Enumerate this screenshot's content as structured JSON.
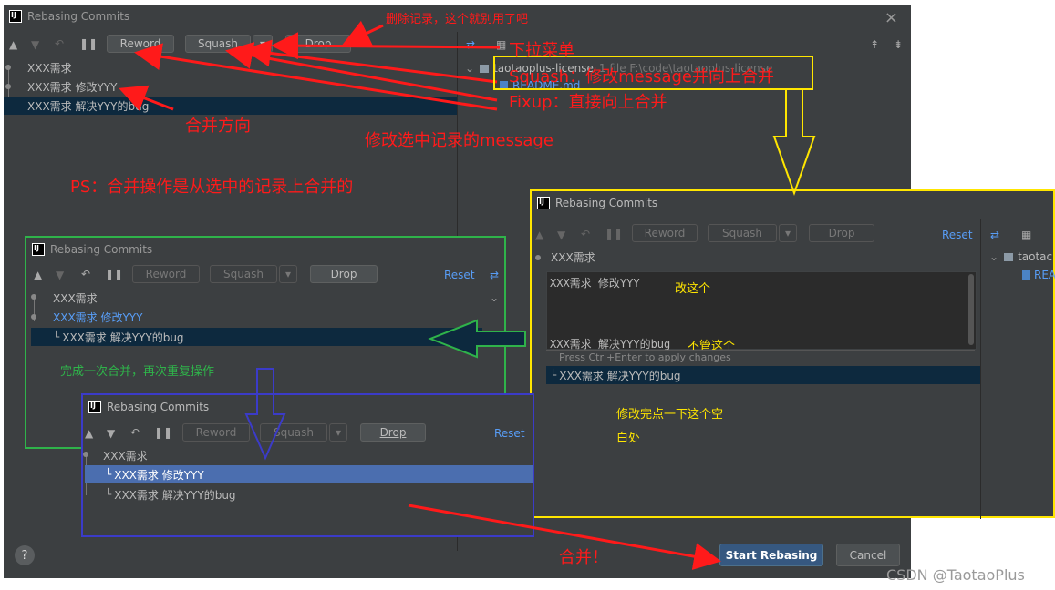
{
  "main": {
    "title": "Rebasing Commits",
    "close": "×",
    "buttons": {
      "reword": "Reword",
      "squash": "Squash",
      "drop": "Drop"
    },
    "commits": [
      "XXX需求",
      "XXX需求 修改YYY",
      "XXX需求 解决YYY的bug"
    ],
    "tree": {
      "repo": "taotaoplus-license",
      "repo_path": "1 file F:\\code\\taotaoplus-license",
      "file": "README.md"
    },
    "help": "?",
    "start": "Start Rebasing",
    "cancel": "Cancel"
  },
  "annotations": {
    "delete": "删除记录，这个就别用了吧",
    "dropdown": "下拉菜单",
    "squash": "Squash：修改message并向上合并",
    "fixup": "Fixup：直接向上合并",
    "direction": "合并方向",
    "reword": "修改选中记录的message",
    "ps": "PS：合并操作是从选中的记录上合并的",
    "repeat": "完成一次合并，再次重复操作",
    "edit_this": "改这个",
    "ignore_this": "不管这个",
    "click_blank_1": "修改完点一下这个空",
    "click_blank_2": "白处",
    "merge": "合并！"
  },
  "green_panel": {
    "title": "Rebasing Commits",
    "reset": "Reset",
    "buttons": {
      "reword": "Reword",
      "squash": "Squash",
      "drop": "Drop"
    },
    "commits": [
      "XXX需求",
      "XXX需求 修改YYY",
      "XXX需求 解决YYY的bug"
    ]
  },
  "yellow_panel": {
    "title": "Rebasing Commits",
    "reset": "Reset",
    "buttons": {
      "reword": "Reword",
      "squash": "Squash",
      "drop": "Drop"
    },
    "commits": [
      "XXX需求",
      "XXX需求 解决YYY的bug"
    ],
    "editor_text": "XXX需求 修改YYY",
    "editor_text_2": "XXX需求 解决YYY的bug",
    "hint": "Press Ctrl+Enter to apply changes",
    "tree": {
      "repo": "taotac",
      "file": "REA"
    }
  },
  "blue_panel": {
    "title": "Rebasing Commits",
    "reset": "Reset",
    "buttons": {
      "reword": "Reword",
      "squash": "Squash",
      "drop": "Drop"
    },
    "commits": [
      "XXX需求",
      "XXX需求 修改YYY",
      "XXX需求 解决YYY的bug"
    ]
  },
  "watermark": "CSDN @TaotaoPlus",
  "colors": {
    "red": "#ff1a1a",
    "yellow": "#ffe600",
    "green": "#2fb34a",
    "blue": "#3b3bc8",
    "link": "#589df6"
  }
}
